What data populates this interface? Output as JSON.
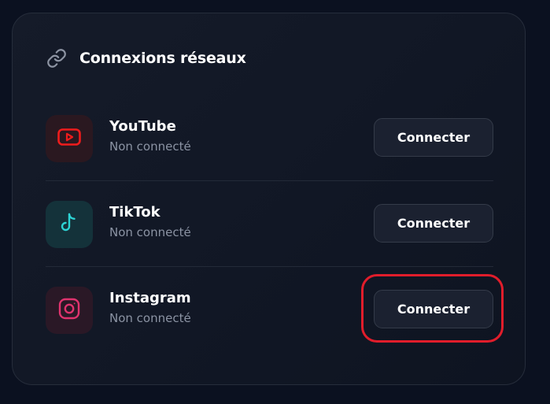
{
  "header": {
    "title": "Connexions réseaux",
    "icon": "link-icon"
  },
  "networks": [
    {
      "name": "YouTube",
      "status": "Non connecté",
      "button_label": "Connecter",
      "icon": "youtube-icon",
      "icon_color": "#ef1c1c"
    },
    {
      "name": "TikTok",
      "status": "Non connecté",
      "button_label": "Connecter",
      "icon": "tiktok-icon",
      "icon_color": "#2dd4d4"
    },
    {
      "name": "Instagram",
      "status": "Non connecté",
      "button_label": "Connecter",
      "icon": "instagram-icon",
      "icon_color": "#e0336e"
    }
  ],
  "colors": {
    "background": "#0b1120",
    "card": "#131a28",
    "highlight": "#e11d2b",
    "muted_text": "#8b93a3"
  }
}
